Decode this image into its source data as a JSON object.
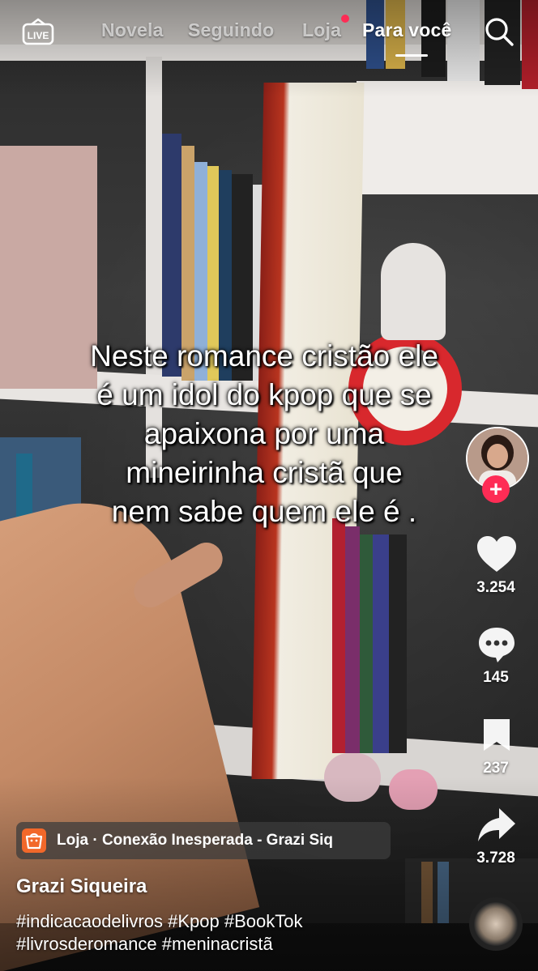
{
  "topnav": {
    "live_label": "LIVE",
    "tabs": [
      {
        "label": "Novela"
      },
      {
        "label": "Seguindo"
      },
      {
        "label": "Loja"
      },
      {
        "label": "Para você"
      }
    ],
    "active_tab": "Para você"
  },
  "caption": {
    "lines": [
      "Neste romance cristão ele",
      "é um idol do kpop que se",
      "apaixona por uma",
      "mineirinha cristã que",
      "nem sabe quem ele é ."
    ]
  },
  "actions": {
    "likes": "3.254",
    "comments": "145",
    "saves": "237",
    "shares": "3.728"
  },
  "shop": {
    "label": "Loja · Conexão Inesperada - Grazi Siq"
  },
  "author": {
    "name": "Grazi Siqueira"
  },
  "description": {
    "hashtags": "#indicacaodelivros #Kpop #BookTok #livrosderomance #meninacristã"
  },
  "colors": {
    "accent": "#fe2c55",
    "shop_icon": "#f2682a"
  },
  "icons": [
    "live-icon",
    "search-icon",
    "heart-icon",
    "comment-icon",
    "bookmark-icon",
    "share-icon",
    "shop-bag-icon",
    "plus-icon"
  ]
}
